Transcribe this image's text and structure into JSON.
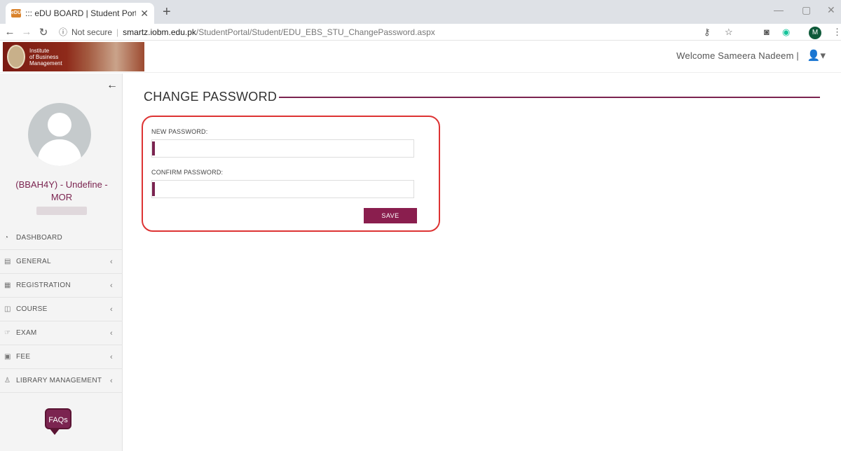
{
  "browser": {
    "tab_title": "::: eDU BOARD | Student Portal :::",
    "favicon_text": "eDU",
    "security_label": "Not secure",
    "url_host": "smartz.iobm.edu.pk",
    "url_path": "/StudentPortal/Student/EDU_EBS_STU_ChangePassword.aspx",
    "profile_initial": "M"
  },
  "header": {
    "logo_text": [
      "Institute",
      "of Business",
      "Management"
    ],
    "welcome": "Welcome Sameera Nadeem |"
  },
  "sidebar": {
    "student_name": "(BBAH4Y) - Undefine - MOR",
    "items": [
      {
        "label": "DASHBOARD",
        "icon": "dashboard-icon",
        "has_chevron": false
      },
      {
        "label": "GENERAL",
        "icon": "general-icon",
        "has_chevron": true
      },
      {
        "label": "REGISTRATION",
        "icon": "registration-icon",
        "has_chevron": true
      },
      {
        "label": "COURSE",
        "icon": "course-icon",
        "has_chevron": true
      },
      {
        "label": "EXAM",
        "icon": "exam-icon",
        "has_chevron": true
      },
      {
        "label": "FEE",
        "icon": "fee-icon",
        "has_chevron": true
      },
      {
        "label": "LIBRARY MANAGEMENT",
        "icon": "library-icon",
        "has_chevron": true
      }
    ],
    "faq_label": "FAQs"
  },
  "main": {
    "title": "CHANGE PASSWORD",
    "new_password_label": "NEW PASSWORD:",
    "new_password_value": "",
    "confirm_password_label": "CONFIRM PASSWORD:",
    "confirm_password_value": "",
    "save_label": "SAVE"
  },
  "colors": {
    "accent": "#7b2450",
    "highlight_border": "#dd3333"
  }
}
